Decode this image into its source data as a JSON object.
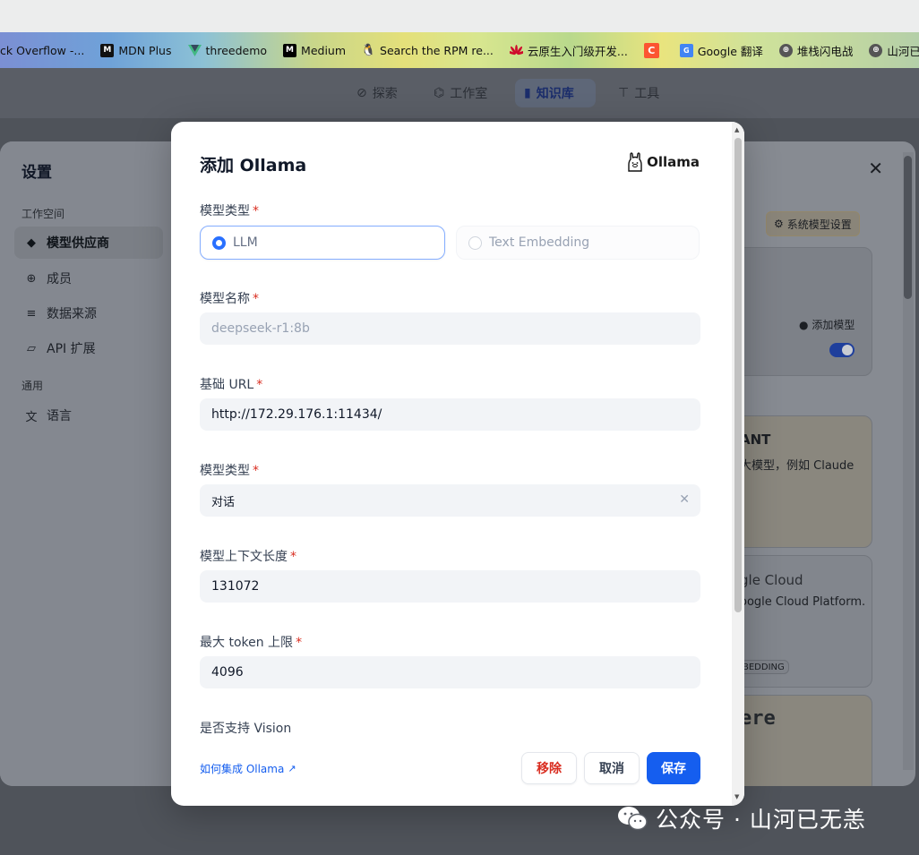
{
  "bookmarks": [
    {
      "label": "ck Overflow -...",
      "icon": "stackoverflow-icon",
      "color": "#f48024"
    },
    {
      "label": "MDN Plus",
      "icon": "mdn-icon",
      "color": "#111111"
    },
    {
      "label": "threedemo",
      "icon": "vue-icon",
      "color": "#42b883"
    },
    {
      "label": "Medium",
      "icon": "medium-icon",
      "color": "#000000"
    },
    {
      "label": "Search the RPM re...",
      "icon": "linux-icon",
      "color": "#333333"
    },
    {
      "label": "云原生入门级开发...",
      "icon": "huawei-icon",
      "color": "#cf0a2c"
    },
    {
      "label": "",
      "icon": "csdn-icon",
      "color": "#fc5531"
    },
    {
      "label": "Google 翻译",
      "icon": "google-translate-icon",
      "color": "#4285f4"
    },
    {
      "label": "堆栈闪电战",
      "icon": "globe-icon",
      "color": "#444444"
    },
    {
      "label": "山河已无恙的",
      "icon": "globe-icon",
      "color": "#444444"
    }
  ],
  "app_nav": {
    "items": [
      {
        "label": "探索",
        "icon": "compass-icon"
      },
      {
        "label": "工作室",
        "icon": "robot-icon"
      },
      {
        "label": "知识库",
        "icon": "book-icon",
        "active": true
      },
      {
        "label": "工具",
        "icon": "hammer-icon"
      }
    ]
  },
  "settings": {
    "title": "设置",
    "group_workspace": "工作空间",
    "group_general": "通用",
    "items": [
      {
        "label": "模型供应商",
        "icon": "cube-icon",
        "active": true
      },
      {
        "label": "成员",
        "icon": "members-icon"
      },
      {
        "label": "数据来源",
        "icon": "database-icon"
      },
      {
        "label": "API 扩展",
        "icon": "puzzle-icon"
      },
      {
        "label": "语言",
        "icon": "translate-icon"
      }
    ],
    "background": {
      "system_model_settings": "系统模型设置",
      "add_model": "添加模型",
      "anthropic_name": "ANT",
      "anthropic_desc": "大模型，例如 Claude",
      "google_name": "gle Cloud",
      "google_desc": "oogle Cloud Platform.",
      "embedding_badge": "BEDDING",
      "cohere_name": "ere"
    }
  },
  "modal": {
    "title": "添加 Ollama",
    "brand": "Ollama",
    "model_type_label": "模型类型",
    "options": [
      "LLM",
      "Text Embedding"
    ],
    "model_name_label": "模型名称",
    "model_name_placeholder": "deepseek-r1:8b",
    "base_url_label": "基础 URL",
    "base_url_value": "http://172.29.176.1:11434/",
    "completion_type_label": "模型类型",
    "completion_type_value": "对话",
    "context_length_label": "模型上下文长度",
    "context_length_value": "131072",
    "max_token_label": "最大 token 上限",
    "max_token_value": "4096",
    "vision_label": "是否支持 Vision",
    "help_link": "如何集成 Ollama",
    "remove": "移除",
    "cancel": "取消",
    "save": "保存",
    "required_mark": "*"
  },
  "watermark": "公众号 · 山河已无恙",
  "colors": {
    "primary": "#155eef",
    "danger": "#d92d20",
    "selected_border": "#84adff"
  }
}
